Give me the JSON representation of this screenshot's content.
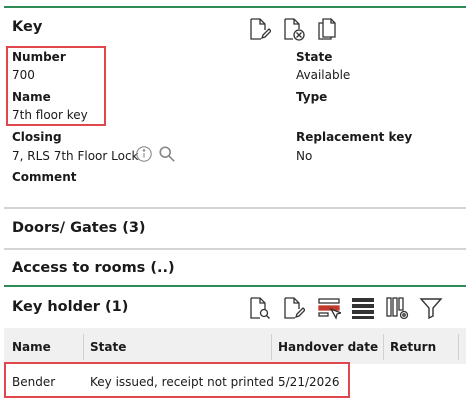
{
  "key_section": {
    "title": "Key",
    "fields": {
      "number_label": "Number",
      "number_value": "700",
      "name_label": "Name",
      "name_value": "7th floor key",
      "closing_label": "Closing",
      "closing_value": "7, RLS 7th Floor Lock",
      "comment_label": "Comment",
      "state_label": "State",
      "state_value": "Available",
      "type_label": "Type",
      "replacement_label": "Replacement key",
      "replacement_value": "No"
    },
    "toolbar_icons": [
      "edit-document-icon",
      "delete-document-icon",
      "copy-document-icon"
    ]
  },
  "doors_section": {
    "title": "Doors/ Gates (3)"
  },
  "access_section": {
    "title": "Access to rooms (..)"
  },
  "key_holder_section": {
    "title": "Key holder (1)",
    "toolbar_icons": [
      "view-document-icon",
      "edit-document-icon",
      "select-column-icon",
      "list-view-icon",
      "column-settings-icon",
      "filter-icon"
    ],
    "columns": [
      "Name",
      "State",
      "Handover date",
      "Return"
    ],
    "rows": [
      {
        "name": "Bender",
        "state": "Key issued, receipt not printed",
        "handover_date": "5/21/2026",
        "return": ""
      }
    ]
  },
  "colors": {
    "accent_green": "#2e8b57",
    "highlight_red": "#e0474c",
    "header_gray": "#f0f0f0"
  }
}
